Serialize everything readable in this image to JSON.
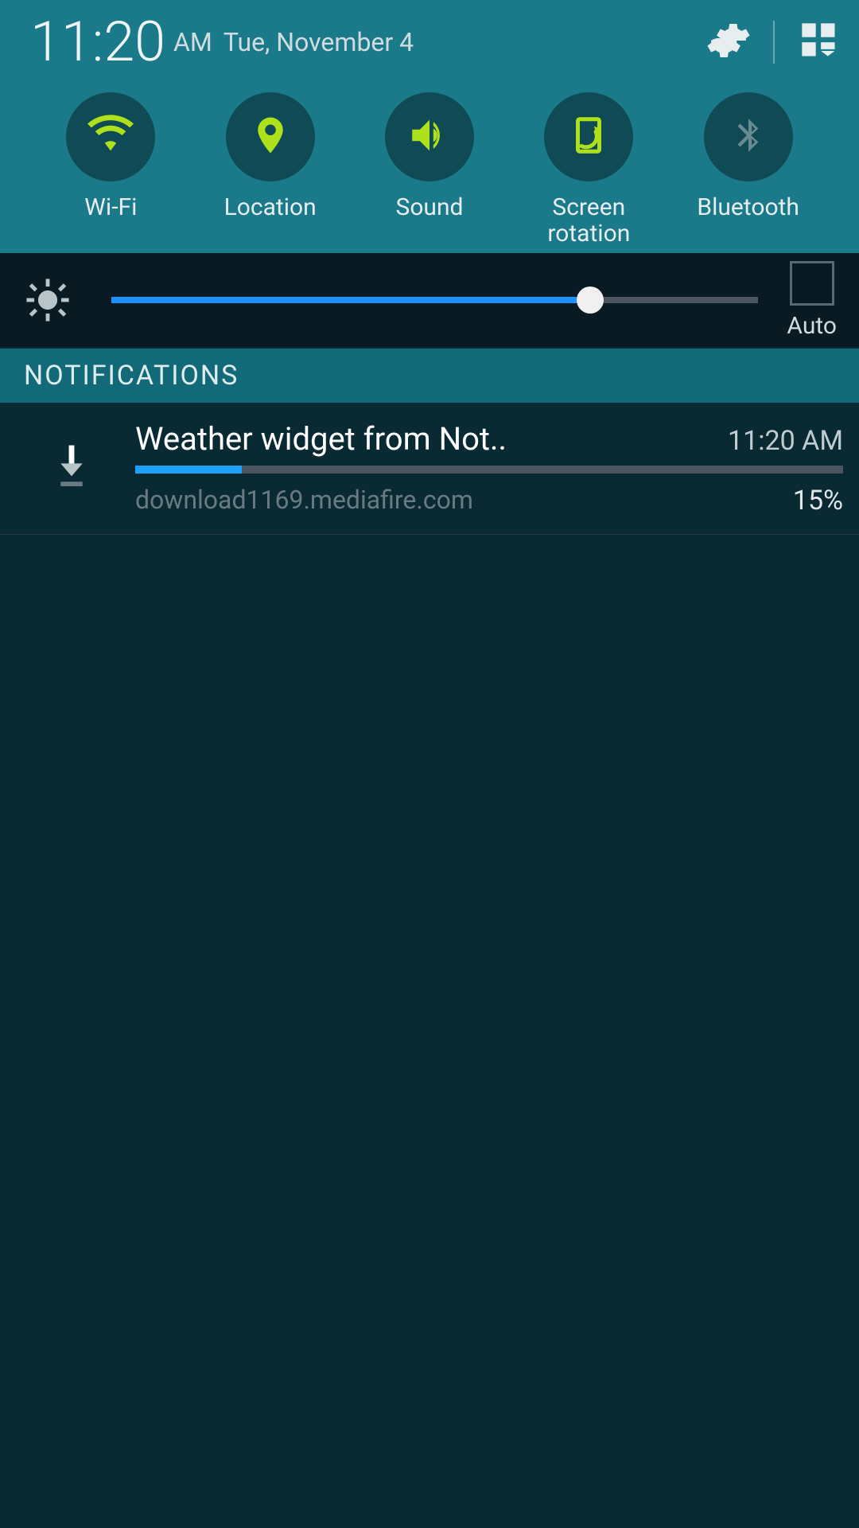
{
  "status": {
    "time": "11:20",
    "ampm": "AM",
    "date": "Tue, November 4"
  },
  "toggles": [
    {
      "id": "wifi",
      "label": "Wi-Fi",
      "active": true
    },
    {
      "id": "location",
      "label": "Location",
      "active": true
    },
    {
      "id": "sound",
      "label": "Sound",
      "active": true
    },
    {
      "id": "rotation",
      "label": "Screen rotation",
      "active": true
    },
    {
      "id": "bluetooth",
      "label": "Bluetooth",
      "active": false
    }
  ],
  "brightness": {
    "auto_label": "Auto",
    "percent": 74
  },
  "notifications_header": "NOTIFICATIONS",
  "notifications": [
    {
      "title": "Weather widget from Not..",
      "time": "11:20 AM",
      "subtitle": "download1169.mediafire.com",
      "percent_text": "15%",
      "percent": 15
    }
  ],
  "colors": {
    "accent": "#aee01c",
    "inactive": "#6a8a92"
  }
}
